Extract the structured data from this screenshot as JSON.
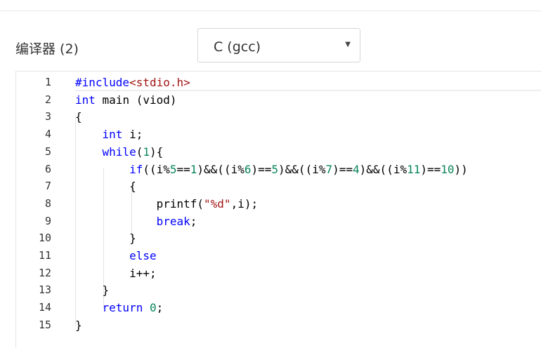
{
  "compiler": {
    "label": "编译器 (2)",
    "selected": "C (gcc)",
    "caret": "▼"
  },
  "colors": {
    "keyword": "#0000ff",
    "number": "#098658",
    "string": "#a31515",
    "text": "#000000"
  },
  "editor": {
    "lines": [
      {
        "num": "1",
        "tokens": [
          {
            "t": "#include",
            "c": "meta"
          },
          {
            "t": "<stdio.h>",
            "c": "inc"
          }
        ]
      },
      {
        "num": "2",
        "tokens": [
          {
            "t": "int",
            "c": "kw"
          },
          {
            "t": " main (viod)",
            "c": "var"
          }
        ]
      },
      {
        "num": "3",
        "tokens": [
          {
            "t": "{",
            "c": "punc"
          }
        ]
      },
      {
        "num": "4",
        "tokens": [
          {
            "t": "    ",
            "c": "var"
          },
          {
            "t": "int",
            "c": "kw"
          },
          {
            "t": " i;",
            "c": "var"
          }
        ]
      },
      {
        "num": "5",
        "tokens": [
          {
            "t": "    ",
            "c": "var"
          },
          {
            "t": "while",
            "c": "kw"
          },
          {
            "t": "(",
            "c": "punc"
          },
          {
            "t": "1",
            "c": "num"
          },
          {
            "t": "){",
            "c": "punc"
          }
        ]
      },
      {
        "num": "6",
        "tokens": [
          {
            "t": "        ",
            "c": "var"
          },
          {
            "t": "if",
            "c": "kw"
          },
          {
            "t": "((i%",
            "c": "var"
          },
          {
            "t": "5",
            "c": "num"
          },
          {
            "t": "==",
            "c": "var"
          },
          {
            "t": "1",
            "c": "num"
          },
          {
            "t": ")&&((i%",
            "c": "var"
          },
          {
            "t": "6",
            "c": "num"
          },
          {
            "t": ")==",
            "c": "var"
          },
          {
            "t": "5",
            "c": "num"
          },
          {
            "t": ")&&((i%",
            "c": "var"
          },
          {
            "t": "7",
            "c": "num"
          },
          {
            "t": ")==",
            "c": "var"
          },
          {
            "t": "4",
            "c": "num"
          },
          {
            "t": ")&&((i%",
            "c": "var"
          },
          {
            "t": "11",
            "c": "num"
          },
          {
            "t": ")==",
            "c": "var"
          },
          {
            "t": "10",
            "c": "num"
          },
          {
            "t": "))",
            "c": "var"
          }
        ]
      },
      {
        "num": "7",
        "tokens": [
          {
            "t": "        ",
            "c": "var"
          },
          {
            "t": "{",
            "c": "punc"
          }
        ]
      },
      {
        "num": "8",
        "tokens": [
          {
            "t": "            printf(",
            "c": "var"
          },
          {
            "t": "\"%d\"",
            "c": "str"
          },
          {
            "t": ",i);",
            "c": "var"
          }
        ]
      },
      {
        "num": "9",
        "tokens": [
          {
            "t": "            ",
            "c": "var"
          },
          {
            "t": "break",
            "c": "kw"
          },
          {
            "t": ";",
            "c": "var"
          }
        ]
      },
      {
        "num": "10",
        "tokens": [
          {
            "t": "        ",
            "c": "var"
          },
          {
            "t": "}",
            "c": "punc"
          }
        ]
      },
      {
        "num": "11",
        "tokens": [
          {
            "t": "        ",
            "c": "var"
          },
          {
            "t": "else",
            "c": "kw"
          }
        ]
      },
      {
        "num": "12",
        "tokens": [
          {
            "t": "        i++;",
            "c": "var"
          }
        ]
      },
      {
        "num": "13",
        "tokens": [
          {
            "t": "    ",
            "c": "var"
          },
          {
            "t": "}",
            "c": "punc"
          }
        ]
      },
      {
        "num": "14",
        "tokens": [
          {
            "t": "    ",
            "c": "var"
          },
          {
            "t": "return",
            "c": "kw"
          },
          {
            "t": " ",
            "c": "var"
          },
          {
            "t": "0",
            "c": "num"
          },
          {
            "t": ";",
            "c": "var"
          }
        ]
      },
      {
        "num": "15",
        "tokens": [
          {
            "t": "}",
            "c": "punc"
          }
        ]
      }
    ]
  }
}
